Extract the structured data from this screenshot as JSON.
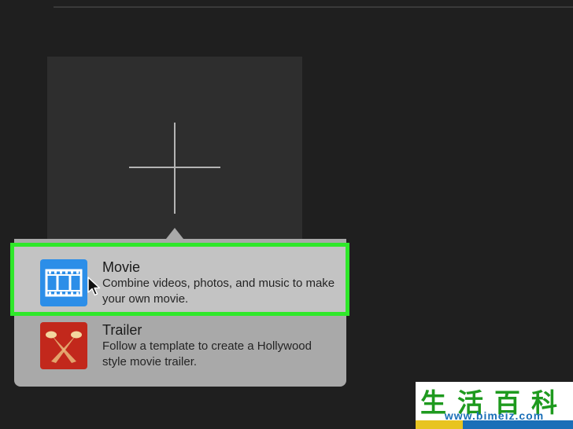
{
  "chooser": {
    "options": [
      {
        "title": "Movie",
        "description": "Combine videos, photos, and music to make your own movie.",
        "icon": "film-strip-icon",
        "selected": true
      },
      {
        "title": "Trailer",
        "description": "Follow a template to create a Hollywood style movie trailer.",
        "icon": "spotlights-icon",
        "selected": false
      }
    ],
    "highlight_color": "#2fe82a"
  },
  "watermark": {
    "chars": "生活百科",
    "url": "www.bimeiz.com"
  }
}
